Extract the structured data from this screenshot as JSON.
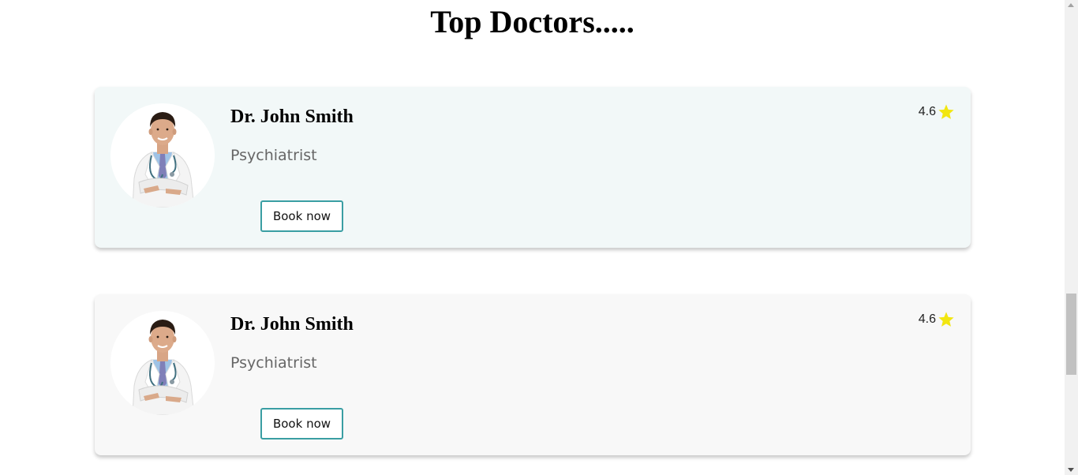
{
  "page": {
    "title": "Top Doctors....."
  },
  "doctors": [
    {
      "name": "Dr. John Smith",
      "specialty": "Psychiatrist",
      "rating": "4.6",
      "book_label": "Book now",
      "avatar_icon": "doctor-portrait",
      "card_bg": "#f2f8f8"
    },
    {
      "name": "Dr. John Smith",
      "specialty": "Psychiatrist",
      "rating": "4.6",
      "book_label": "Book now",
      "avatar_icon": "doctor-portrait",
      "card_bg": "#f8f8f8"
    }
  ],
  "colors": {
    "button_border": "#3a9ea3",
    "star": "#f2e611",
    "specialty_text": "#666666"
  }
}
